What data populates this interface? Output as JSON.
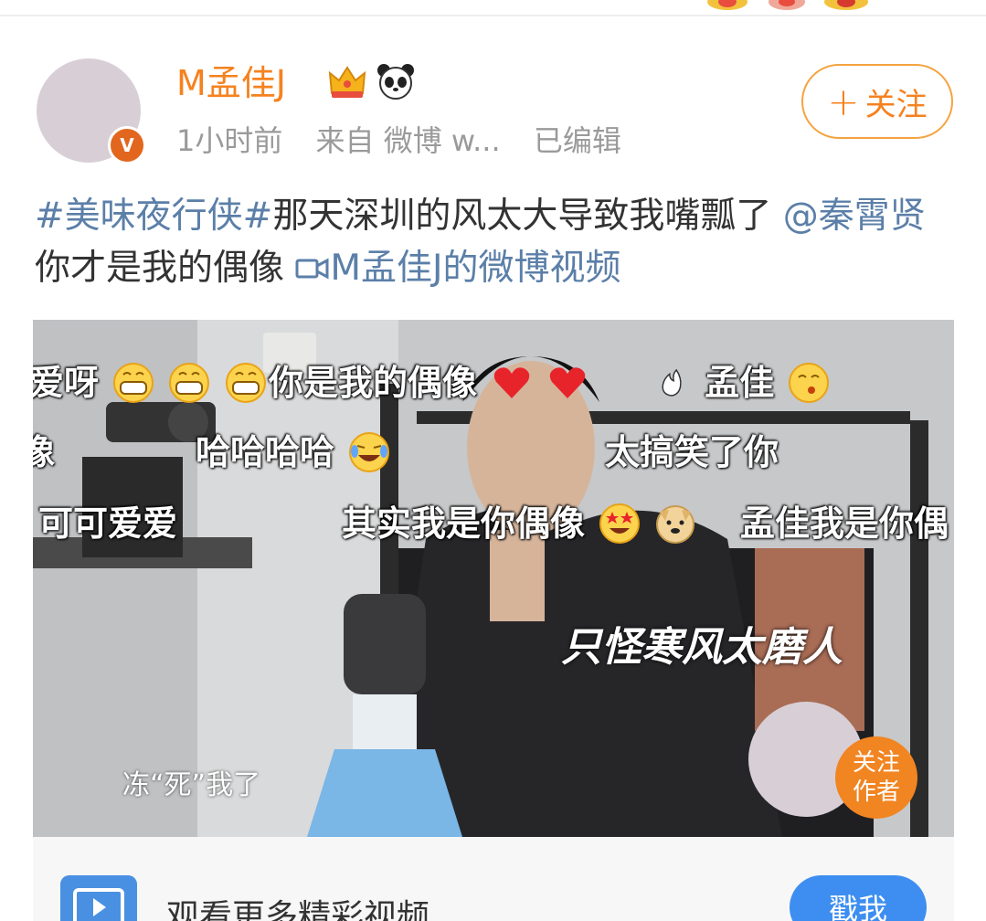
{
  "user": {
    "name": "M孟佳J",
    "avatar_icon": "avatar-placeholder",
    "verified_icon": "verified-v-badge-icon",
    "badge_letter": "V",
    "badges": [
      "crown-icon",
      "panda-icon"
    ]
  },
  "meta": {
    "time": "1小时前",
    "source": "来自 微博 w...",
    "edited": "已编辑"
  },
  "follow_button": {
    "plus": "+",
    "label": "关注"
  },
  "post": {
    "hashtag": "#美味夜行侠#",
    "text1": "那天深圳的风太大导致我嘴瓢了 ",
    "mention": "@秦霄贤",
    "text2": " 你才是我的偶像 ",
    "video_link": "M孟佳J的微博视频"
  },
  "video": {
    "danmaku": [
      {
        "text": "爱呀",
        "emoji": [
          "grin-emoji",
          "grin-emoji",
          "grin-emoji"
        ]
      },
      {
        "text": "你是我的偶像",
        "emoji": [
          "heart-emoji",
          "heart-emoji"
        ]
      },
      {
        "text": "孟佳",
        "emoji": [
          "kiss-emoji"
        ]
      },
      {
        "text": "像",
        "emoji": []
      },
      {
        "text": "哈哈哈哈",
        "emoji": [
          "laugh-cry-emoji"
        ]
      },
      {
        "text": "太搞笑了你",
        "emoji": []
      },
      {
        "text": "可可爱爱",
        "emoji": []
      },
      {
        "text": "其实我是你偶像",
        "emoji": [
          "star-eyes-emoji",
          "doge-emoji"
        ]
      },
      {
        "text": "孟佳我是你偶",
        "emoji": []
      }
    ],
    "caption_big": "只怪寒风太磨人",
    "caption_small": "冻“死”我了",
    "follow_author": [
      "关注",
      "作者"
    ]
  },
  "more_bar": {
    "icon": "video-play-icon",
    "text": "观看更多精彩视频",
    "button": "戳我"
  },
  "colors": {
    "accent_orange": "#f5821f",
    "link_blue": "#5b7fa8",
    "button_blue": "#3d8ef0"
  }
}
